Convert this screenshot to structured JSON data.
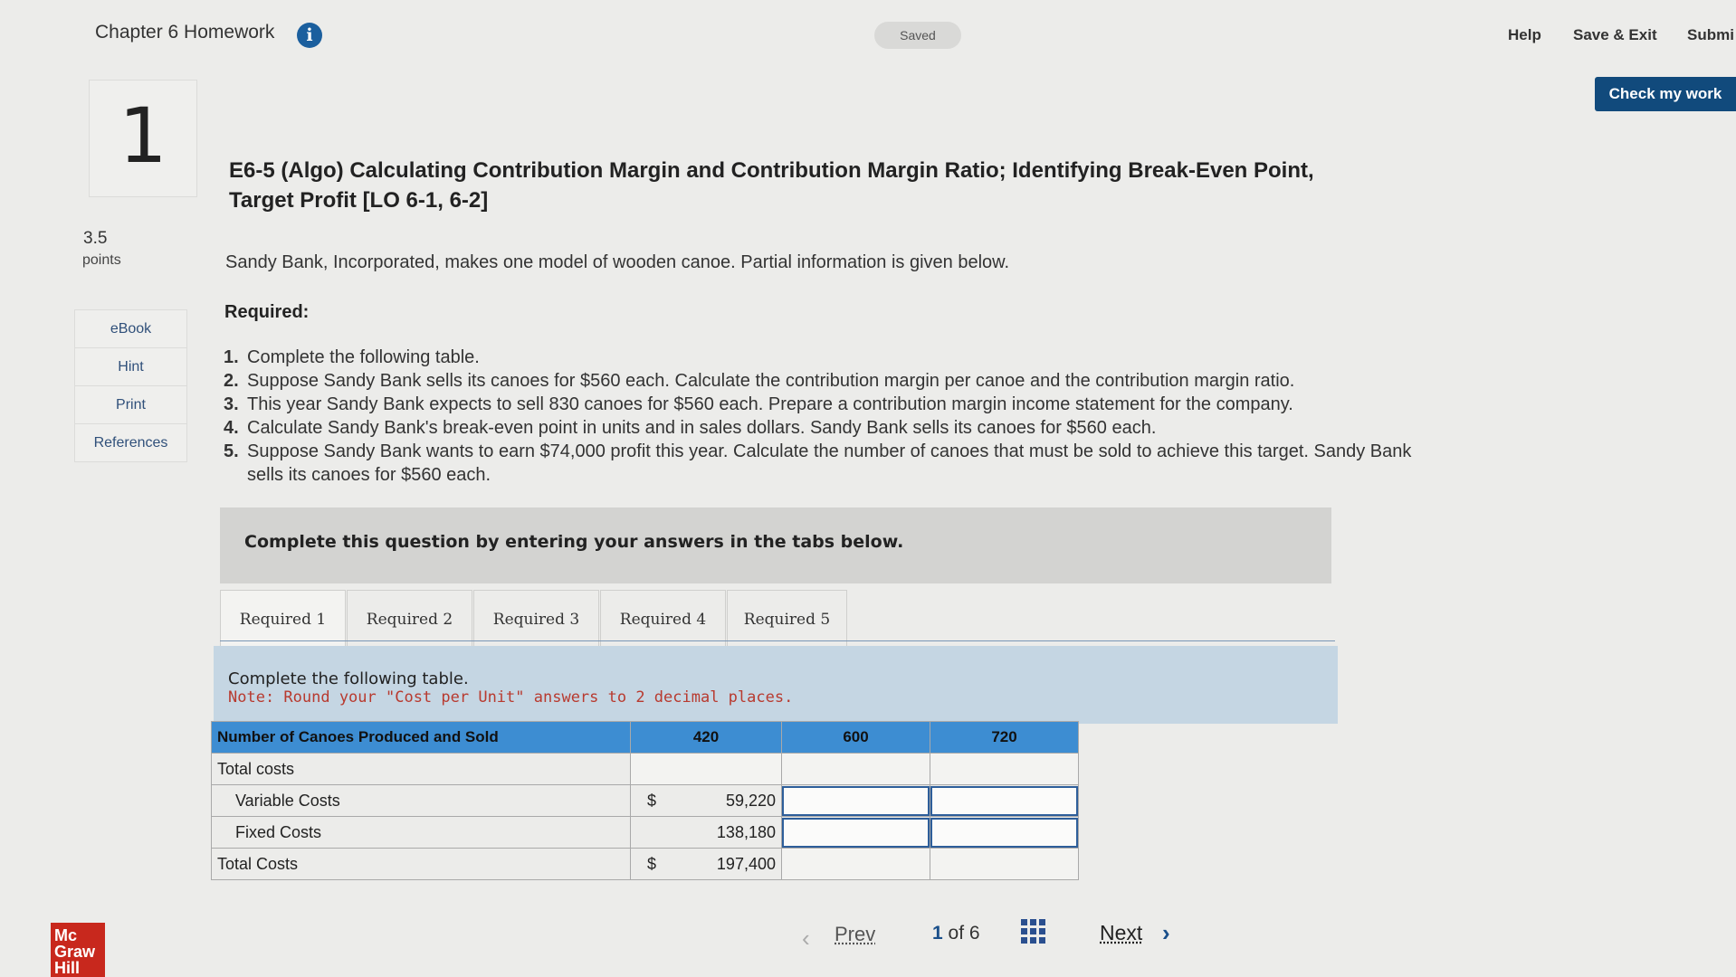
{
  "header": {
    "assignment_title": "Chapter 6 Homework",
    "info_icon_glyph": "i",
    "saved_label": "Saved",
    "help_label": "Help",
    "save_exit_label": "Save & Exit",
    "submit_label": "Submi",
    "check_work_label": "Check my work"
  },
  "question_nav": {
    "number": "1",
    "points_value": "3.5",
    "points_label": "points"
  },
  "side_tools": [
    "eBook",
    "Hint",
    "Print",
    "References"
  ],
  "question": {
    "title": "E6-5 (Algo) Calculating Contribution Margin and Contribution Margin Ratio; Identifying Break-Even Point, Target Profit [LO 6-1, 6-2]",
    "intro": "Sandy Bank, Incorporated, makes one model of wooden canoe. Partial information is given below.",
    "required_heading": "Required:",
    "requirements": [
      {
        "num": "1.",
        "text": "Complete the following table."
      },
      {
        "num": "2.",
        "text": "Suppose Sandy Bank sells its canoes for $560 each. Calculate the contribution margin per canoe and the contribution margin ratio."
      },
      {
        "num": "3.",
        "text": "This year Sandy Bank expects to sell 830 canoes for $560 each. Prepare a contribution margin income statement for the company."
      },
      {
        "num": "4.",
        "text": "Calculate Sandy Bank's break-even point in units and in sales dollars. Sandy Bank sells its canoes for $560 each."
      },
      {
        "num": "5.",
        "text": "Suppose Sandy Bank wants to earn $74,000 profit this year. Calculate the number of canoes that must be sold to achieve this target. Sandy Bank sells its canoes for $560 each."
      }
    ]
  },
  "instruction_bar": "Complete this question by entering your answers in the tabs below.",
  "tabs": [
    "Required 1",
    "Required 2",
    "Required 3",
    "Required 4",
    "Required 5"
  ],
  "active_tab_index": 0,
  "panel": {
    "line1": "Complete the following table.",
    "note": "Note: Round your \"Cost per Unit\" answers to 2 decimal places."
  },
  "table": {
    "header_label": "Number of Canoes Produced and Sold",
    "columns": [
      "420",
      "600",
      "720"
    ],
    "section_total_costs": "Total costs",
    "variable_label": "Variable Costs",
    "fixed_label": "Fixed Costs",
    "total_label": "Total Costs",
    "currency": "$",
    "variable_420": "59,220",
    "fixed_420": "138,180",
    "total_420": "197,400",
    "variable_600": "",
    "variable_720": "",
    "fixed_600": "",
    "fixed_720": ""
  },
  "footer": {
    "prev_label": "Prev",
    "page_current": "1",
    "page_of": "of",
    "page_total": "6",
    "next_label": "Next",
    "logo_line1": "Mc",
    "logo_line2": "Graw",
    "logo_line3": "Hill"
  },
  "colors": {
    "header_blue": "#3d8dd2",
    "panel_blue": "#c5d6e3",
    "button_navy": "#114a7c",
    "note_red": "#b83a2f",
    "brand_red": "#c8281d"
  }
}
